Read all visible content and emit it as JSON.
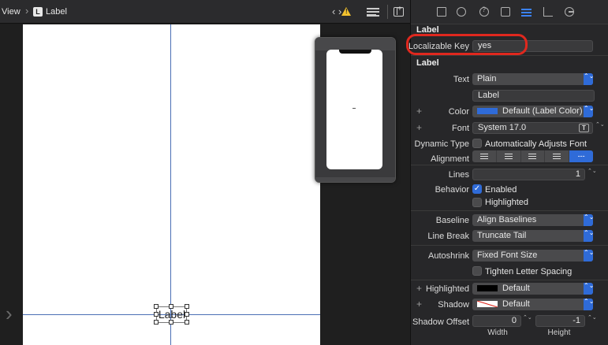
{
  "jumpbar": {
    "crumb_prev": "View",
    "crumb_current": "Label",
    "badge": "L",
    "nav_arrows": "‹ ›",
    "warning_mark": "!"
  },
  "canvas": {
    "label_text": "Label"
  },
  "inspector": {
    "tabs": [
      "file-icon",
      "history-icon",
      "help-icon",
      "identity-icon",
      "attributes-icon",
      "size-icon",
      "connections-icon"
    ],
    "section1_title": "Label",
    "localizable_key_label": "Localizable Key",
    "localizable_key_value": "yes",
    "section2_title": "Label",
    "text_label": "Text",
    "text_value": "Plain",
    "text_content": "Label",
    "color_label": "Color",
    "color_value": "Default (Label Color)",
    "font_label": "Font",
    "font_value": "System 17.0",
    "font_button": "T",
    "dynamic_type_label": "Dynamic Type",
    "dynamic_type_value": "Automatically Adjusts Font",
    "alignment_label": "Alignment",
    "alignment_natural": "---",
    "lines_label": "Lines",
    "lines_value": "1",
    "behavior_label": "Behavior",
    "behavior_enabled": "Enabled",
    "behavior_highlighted": "Highlighted",
    "baseline_label": "Baseline",
    "baseline_value": "Align Baselines",
    "linebreak_label": "Line Break",
    "linebreak_value": "Truncate Tail",
    "autoshrink_label": "Autoshrink",
    "autoshrink_value": "Fixed Font Size",
    "tighten_label": "Tighten Letter Spacing",
    "highlighted_label": "Highlighted",
    "highlighted_value": "Default",
    "shadow_label": "Shadow",
    "shadow_value": "Default",
    "shadow_offset_label": "Shadow Offset",
    "shadow_offset_width": "0",
    "shadow_offset_height": "-1",
    "width_label": "Width",
    "height_label": "Height",
    "plus": "+",
    "check": "✓",
    "chevrons": "⌃⌄"
  },
  "colors": {
    "accent": "#2f6bd8",
    "highlight_ring": "#e0281e",
    "label_color_swatch": "#2f6bd8",
    "highlighted_swatch": "#000000",
    "shadow_swatch": "#ffffff"
  }
}
